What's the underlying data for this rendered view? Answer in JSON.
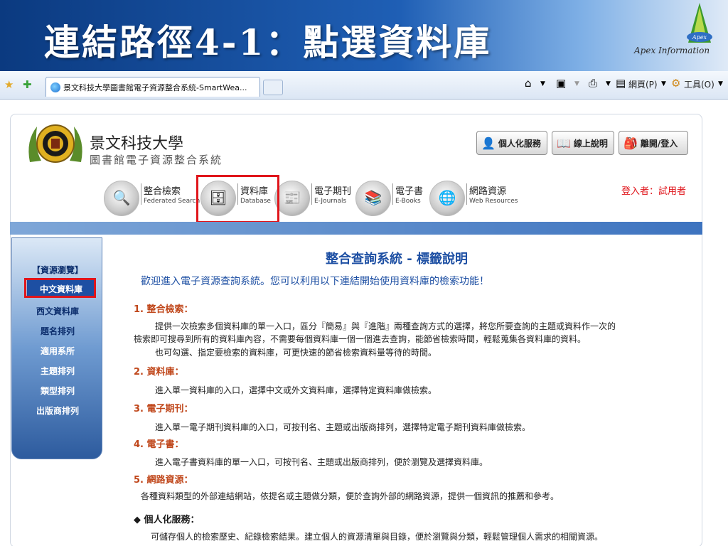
{
  "slide": {
    "title": "連結路徑4-1：點選資料庫",
    "brand": "Apex Information",
    "brand_logo_text": "Apex"
  },
  "browser": {
    "tab_title": "景文科技大學圖書館電子資源整合系統-SmartWea...",
    "toolbar": {
      "page_label": "網頁(P)",
      "tools_label": "工具(O)"
    }
  },
  "header": {
    "school_name": "景文科技大學",
    "system_name": "圖書館電子資源整合系統",
    "buttons": [
      {
        "label": "個人化服務"
      },
      {
        "label": "線上說明"
      },
      {
        "label": "離開/登入"
      }
    ],
    "login_user": "登入者：試用者"
  },
  "nav": [
    {
      "zh": "整合檢索",
      "en": "Federated Search"
    },
    {
      "zh": "資料庫",
      "en": "Database"
    },
    {
      "zh": "電子期刊",
      "en": "E-Journals"
    },
    {
      "zh": "電子書",
      "en": "E-Books"
    },
    {
      "zh": "網路資源",
      "en": "Web Resources"
    }
  ],
  "sidebar": {
    "title": "【資源瀏覽】",
    "items": [
      "中文資料庫",
      "西文資料庫",
      "題名排列",
      "適用系所",
      "主題排列",
      "類型排列",
      "出版商排列"
    ]
  },
  "main": {
    "title": "整合查詢系統 - 標籤說明",
    "welcome": "歡迎進入電子資源查詢系統。您可以利用以下連結開始使用資料庫的檢索功能！",
    "sections": [
      {
        "heading": "1. 整合檢索：",
        "lines": [
          "提供一次檢索多個資料庫的單一入口，區分『簡易』與『進階』兩種查詢方式的選擇，將您所要查詢的主題或資料作一次的",
          "檢索即可搜尋到所有的資料庫內容，不需要每個資料庫一個一個進去查詢，能節省檢索時間，輕鬆蒐集各資料庫的資料。",
          "也可勾選、指定要檢索的資料庫，可更快速的節省檢索資料量等待的時間。"
        ]
      },
      {
        "heading": "2. 資料庫：",
        "lines": [
          "進入單一資料庫的入口，選擇中文或外文資料庫，選擇特定資料庫做檢索。"
        ]
      },
      {
        "heading": "3. 電子期刊：",
        "lines": [
          "進入單一電子期刊資料庫的入口，可按刊名、主題或出版商排列，選擇特定電子期刊資料庫做檢索。"
        ]
      },
      {
        "heading": "4. 電子書：",
        "lines": [
          "進入電子書資料庫的單一入口，可按刊名、主題或出版商排列，便於瀏覽及選擇資料庫。"
        ]
      },
      {
        "heading": "5. 網路資源：",
        "lines": [
          "各種資料類型的外部連結網站，依提名或主題做分類，便於查詢外部的網路資源，提供一個資訊的推薦和參考。"
        ]
      },
      {
        "heading": "◆ 個人化服務：",
        "lines": [
          "可儲存個人的檢索歷史、紀錄檢索結果。建立個人的資源清單與目錄，便於瀏覽與分類，輕鬆管理個人需求的相關資源。"
        ]
      }
    ]
  }
}
